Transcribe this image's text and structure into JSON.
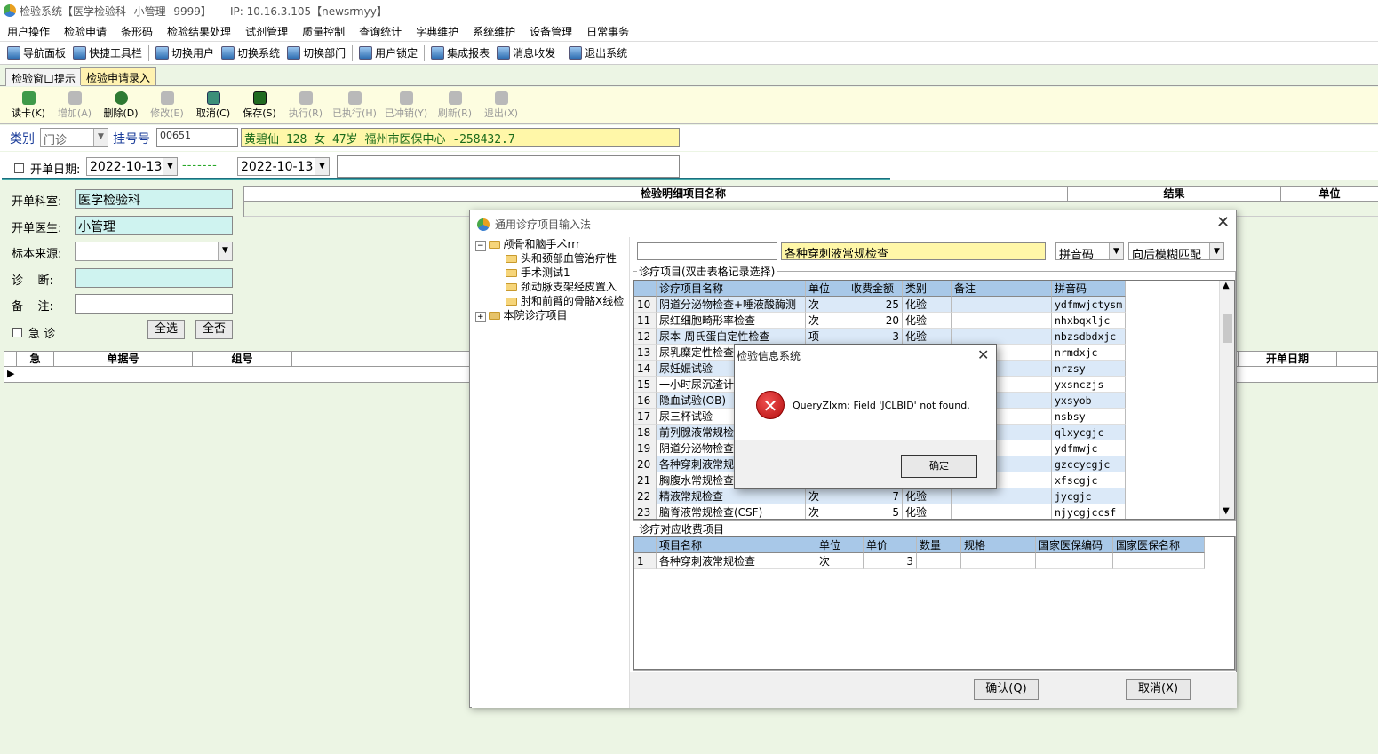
{
  "window": {
    "title": "检验系统【医学检验科--小管理--9999】---- IP: 10.16.3.105【newsrmyy】"
  },
  "menu": [
    "用户操作",
    "检验申请",
    "条形码",
    "检验结果处理",
    "试剂管理",
    "质量控制",
    "查询统计",
    "字典维护",
    "系统维护",
    "设备管理",
    "日常事务"
  ],
  "toolbar1": [
    "导航面板",
    "快捷工具栏",
    "切换用户",
    "切换系统",
    "切换部门",
    "用户锁定",
    "集成报表",
    "消息收发",
    "退出系统"
  ],
  "tabs": [
    "检验窗口提示",
    "检验申请录入"
  ],
  "toolbar2": [
    {
      "label": "读卡(K)",
      "enabled": true,
      "icon": "card-reader-icon"
    },
    {
      "label": "增加(A)",
      "enabled": false,
      "icon": "add-icon"
    },
    {
      "label": "删除(D)",
      "enabled": true,
      "icon": "delete-icon"
    },
    {
      "label": "修改(E)",
      "enabled": false,
      "icon": "edit-icon"
    },
    {
      "label": "取消(C)",
      "enabled": true,
      "icon": "cancel-icon"
    },
    {
      "label": "保存(S)",
      "enabled": true,
      "icon": "save-icon"
    },
    {
      "label": "执行(R)",
      "enabled": false,
      "icon": "execute-icon"
    },
    {
      "label": "已执行(H)",
      "enabled": false,
      "icon": "executed-icon"
    },
    {
      "label": "已冲销(Y)",
      "enabled": false,
      "icon": "reversed-icon"
    },
    {
      "label": "刷新(R)",
      "enabled": false,
      "icon": "refresh-icon"
    },
    {
      "label": "退出(X)",
      "enabled": false,
      "icon": "exit-icon"
    }
  ],
  "patient": {
    "category_label": "类别",
    "category_value": "门诊",
    "reg_label": "挂号号",
    "reg_value": "00651",
    "info": "黄碧仙 128 女 47岁 福州市医保中心 -258432.7"
  },
  "date": {
    "checkbox_label": "开单日期:",
    "from": "2022-10-13",
    "dashes": "-------",
    "to": "2022-10-13",
    "extra": ""
  },
  "form": {
    "dept_label": "开单科室:",
    "dept_value": "医学检验科",
    "doctor_label": "开单医生:",
    "doctor_value": "小管理",
    "specimen_label": "标本来源:",
    "specimen_value": "",
    "diagnosis_label": "诊    断:",
    "diagnosis_value": "",
    "remark_label": "备    注:",
    "remark_value": "",
    "urgent_label": "急 诊",
    "select_all": "全选",
    "deselect_all": "全否"
  },
  "right_grid_headers": [
    "检验明细项目名称",
    "结果",
    "单位"
  ],
  "bottom_grid_headers": [
    "急",
    "单据号",
    "组号",
    "开单日期"
  ],
  "dialog": {
    "title": "通用诊疗项目输入法",
    "tree": [
      {
        "text": "颅骨和脑手术rrr",
        "level": 0,
        "expanded": true
      },
      {
        "text": "头和颈部血管治疗性",
        "level": 1
      },
      {
        "text": "手术测试1",
        "level": 1
      },
      {
        "text": "颈动脉支架经皮置入",
        "level": 1
      },
      {
        "text": "肘和前臂的骨骼X线检",
        "level": 1
      },
      {
        "text": "本院诊疗项目",
        "level": 0,
        "expanded": false
      }
    ],
    "search_value": "",
    "search_text": "各种穿刺液常规检查",
    "search_mode": "拼音码",
    "match_mode": "向后模糊匹配",
    "items_group": "诊疗项目(双击表格记录选择)",
    "items_headers": [
      "",
      "诊疗项目名称",
      "单位",
      "收费金额",
      "类别",
      "备注",
      "拼音码"
    ],
    "items": [
      [
        "10",
        "阴道分泌物检查+唾液酸酶测",
        "次",
        "25",
        "化验",
        "",
        "ydfmwjctysm"
      ],
      [
        "11",
        "尿红细胞畸形率检查",
        "次",
        "20",
        "化验",
        "",
        "nhxbqxljc"
      ],
      [
        "12",
        "尿本-周氏蛋白定性检查",
        "项",
        "3",
        "化验",
        "",
        "nbzsdbdxjc"
      ],
      [
        "13",
        "尿乳糜定性检查",
        "",
        "",
        "",
        "",
        "nrmdxjc"
      ],
      [
        "14",
        "尿妊娠试验",
        "",
        "",
        "",
        "",
        "nrzsy"
      ],
      [
        "15",
        "一小时尿沉渣计",
        "",
        "",
        "",
        "",
        "yxsnczjs"
      ],
      [
        "16",
        "隐血试验(OB)",
        "",
        "",
        "",
        "",
        "yxsyob"
      ],
      [
        "17",
        "尿三杯试验",
        "",
        "",
        "",
        "",
        "nsbsy"
      ],
      [
        "18",
        "前列腺液常规检",
        "",
        "",
        "",
        "",
        "qlxycgjc"
      ],
      [
        "19",
        "阴道分泌物检查",
        "",
        "",
        "",
        "",
        "ydfmwjc"
      ],
      [
        "20",
        "各种穿刺液常规",
        "",
        "",
        "",
        "",
        "gzccycgjc"
      ],
      [
        "21",
        "胸腹水常规检查",
        "",
        "",
        "",
        "",
        "xfscgjc"
      ],
      [
        "22",
        "精液常规检查",
        "次",
        "7",
        "化验",
        "",
        "jycgjc"
      ],
      [
        "23",
        "脑脊液常规检查(CSF)",
        "次",
        "5",
        "化验",
        "",
        "njycgjccsf"
      ]
    ],
    "fee_group": "诊疗对应收费项目",
    "fee_headers": [
      "",
      "项目名称",
      "单位",
      "单价",
      "数量",
      "规格",
      "国家医保编码",
      "国家医保名称"
    ],
    "fee_rows": [
      [
        "1",
        "各种穿刺液常规检查",
        "次",
        "3",
        "",
        "",
        "",
        ""
      ]
    ],
    "confirm": "确认(Q)",
    "cancel": "取消(X)"
  },
  "message": {
    "title": "检验信息系统",
    "text": "QueryZlxm: Field 'JCLBID' not found.",
    "ok": "确定"
  }
}
